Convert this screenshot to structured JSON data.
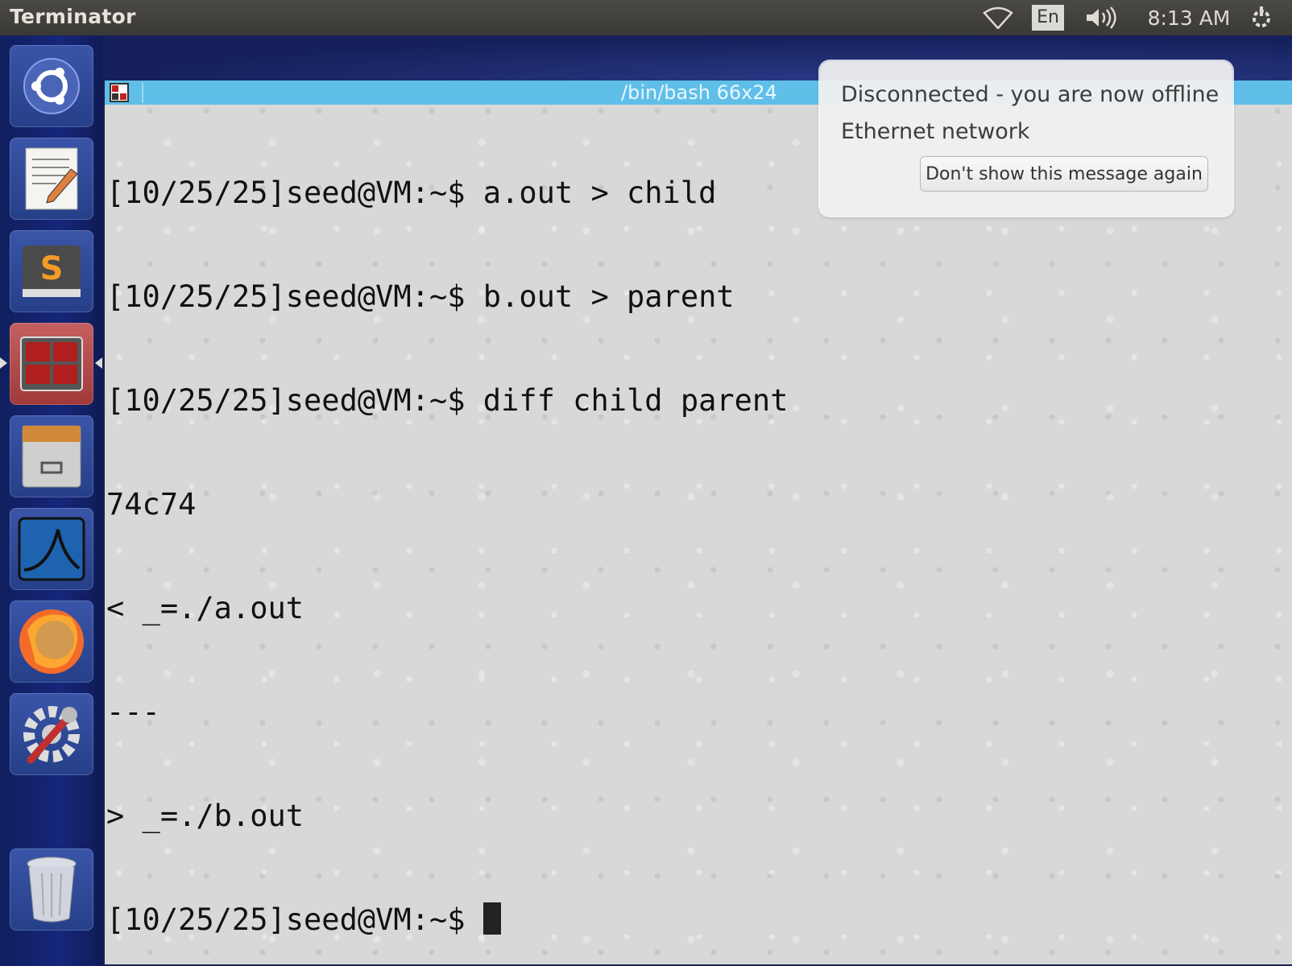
{
  "topbar": {
    "app_title": "Terminator",
    "language": "En",
    "clock": "8:13 AM",
    "icons": [
      "network-wifi-icon",
      "volume-icon",
      "system-gear-icon"
    ]
  },
  "launcher": {
    "items": [
      {
        "name": "ubuntu-dash-icon"
      },
      {
        "name": "text-editor-icon"
      },
      {
        "name": "sublime-text-icon"
      },
      {
        "name": "terminator-icon",
        "active": true
      },
      {
        "name": "files-icon"
      },
      {
        "name": "wireshark-icon"
      },
      {
        "name": "firefox-icon"
      },
      {
        "name": "system-settings-icon"
      },
      {
        "name": "trash-icon"
      }
    ]
  },
  "terminal": {
    "title": "/bin/bash 66x24",
    "lines": [
      "[10/25/25]seed@VM:~$ a.out > child",
      "[10/25/25]seed@VM:~$ b.out > parent",
      "[10/25/25]seed@VM:~$ diff child parent",
      "74c74",
      "< _=./a.out",
      "---",
      "> _=./b.out",
      "[10/25/25]seed@VM:~$ "
    ]
  },
  "notification": {
    "title": "Disconnected - you are now offline",
    "body": "Ethernet network",
    "button": "Don't show this message again"
  },
  "colors": {
    "terminal_titlebar": "#5fbfe8",
    "launcher_bg": "#16267a",
    "topbar_bg": "#3a3935"
  }
}
